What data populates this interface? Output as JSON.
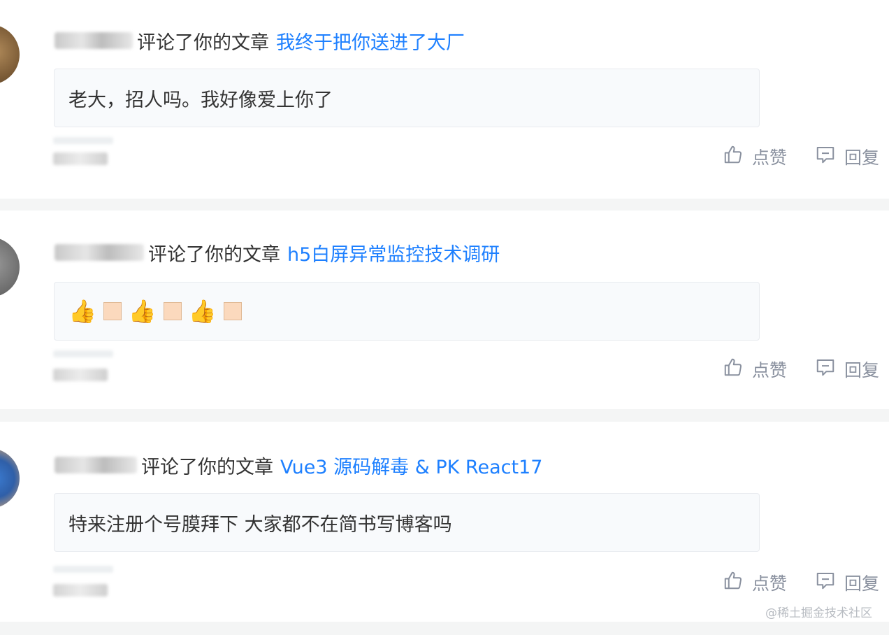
{
  "notifications": [
    {
      "action_text": "评论了你的文章",
      "article_title": "我终于把你送进了大厂",
      "comment_text": "老大，招人吗。我好像爱上你了",
      "like_label": "点赞",
      "reply_label": "回复"
    },
    {
      "action_text": "评论了你的文章",
      "article_title": "h5白屏异常监控技术调研",
      "comment_emojis": [
        "👍",
        "square",
        "👍",
        "square",
        "👍",
        "square"
      ],
      "like_label": "点赞",
      "reply_label": "回复"
    },
    {
      "action_text": "评论了你的文章",
      "article_title": "Vue3 源码解毒 & PK React17",
      "comment_text": "特来注册个号膜拜下 大家都不在简书写博客吗",
      "like_label": "点赞",
      "reply_label": "回复"
    }
  ],
  "watermark": "@稀土掘金技术社区",
  "colors": {
    "link": "#1e80ff",
    "muted": "#8a919f",
    "comment_bg": "#f8fafc",
    "page_bg": "#f4f5f5"
  },
  "icons": [
    "thumbs-up-icon",
    "comment-reply-icon"
  ]
}
